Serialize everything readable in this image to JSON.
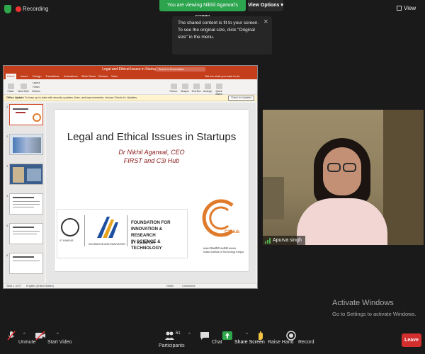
{
  "top_bar": {
    "recording_label": "Recording",
    "viewing_banner": "You are viewing Nikhil Agarwal's screen",
    "view_options_label": "View Options",
    "view_label": "View"
  },
  "tooltip": {
    "text": "The shared content is fit to your screen. To see the original size, click \"Original size\" in the menu."
  },
  "powerpoint": {
    "window_title": "Legal and Ethical Issues in Startups",
    "search_placeholder": "Search in Presentation",
    "tabs": [
      "Home",
      "Insert",
      "Design",
      "Transitions",
      "Animations",
      "Slide Show",
      "Review",
      "View"
    ],
    "tell_me": "Tell me what you want to do",
    "ribbon_buttons": [
      "Paste",
      "New Slide",
      "Layout",
      "Reset",
      "Section",
      "Picture",
      "Shapes",
      "Text Box",
      "Arrange",
      "Quick Styles"
    ],
    "notice_title": "Office Update",
    "notice_text": "To keep up-to-date with security updates, fixes, and improvements, choose Check for Updates.",
    "notice_button": "Check for Updates",
    "thumbnail_numbers": [
      "1",
      "2",
      "3",
      "4",
      "5",
      "6"
    ],
    "status_left": "Slide 1 of 27",
    "status_lang": "English (United States)",
    "status_notes": "Notes",
    "status_comments": "Comments"
  },
  "slide": {
    "title": "Legal and Ethical Issues in Startups",
    "subtitle_1": "Dr Nikhil Agarwal, CEO",
    "subtitle_2": "FIRST and C3i Hub",
    "iitk_label": "IIT KANPUR",
    "incubation_label": "INCUBATION AND INNOVATION",
    "foundation_lines": [
      "FOUNDATION FOR",
      "INNOVATION & RESEARCH",
      "IN SCIENCE & TECHNOLOGY"
    ],
    "foundation_iit": "IIT KANPUR",
    "c3i_label": "C3iHub",
    "c3i_tag1": "सायबर सिक्योरिटी तकनीकी समाधान",
    "c3i_tag2": "Indian Institute of Technology Kanpur"
  },
  "participant": {
    "name": "Apurva singh"
  },
  "activation": {
    "title": "Activate Windows",
    "subtitle": "Go to Settings to activate Windows."
  },
  "bottom_bar": {
    "unmute": "Unmute",
    "start_video": "Start Video",
    "participants": "Participants",
    "participants_count": "61",
    "chat": "Chat",
    "share_screen": "Share Screen",
    "raise_hand": "Raise Hand",
    "record": "Record",
    "leave": "Leave"
  },
  "colors": {
    "banner_green": "#2da44e",
    "leave_red": "#d32f2f",
    "ppt_orange": "#c43e1c",
    "share_green": "#2ea84a"
  }
}
